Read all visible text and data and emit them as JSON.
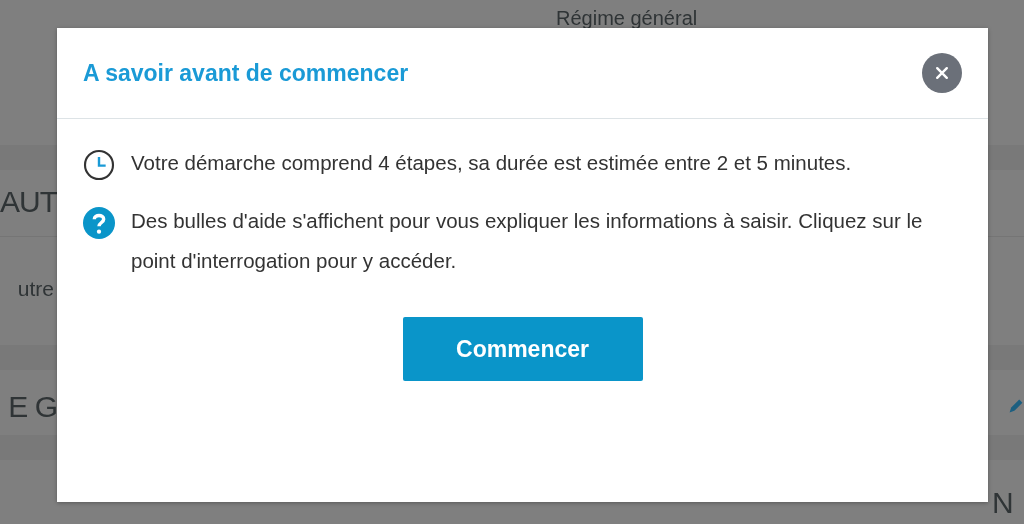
{
  "background": {
    "heading": "Régime général",
    "left_fragments": [
      {
        "text": "AUT",
        "kind": "heading"
      },
      {
        "text": "utre",
        "kind": "body"
      },
      {
        "text": "E G",
        "kind": "heading"
      }
    ],
    "right_fragment": "N"
  },
  "dialog": {
    "title": "A savoir avant de commencer",
    "items": [
      {
        "kind": "clock",
        "text": "Votre démarche comprend 4 étapes, sa durée est estimée entre 2 et 5 minutes."
      },
      {
        "kind": "help",
        "text": "Des bulles d'aide s'affichent pour vous expliquer les informations à saisir. Cliquez sur le point d'interrogation pour y accéder."
      }
    ],
    "button": "Commencer"
  }
}
